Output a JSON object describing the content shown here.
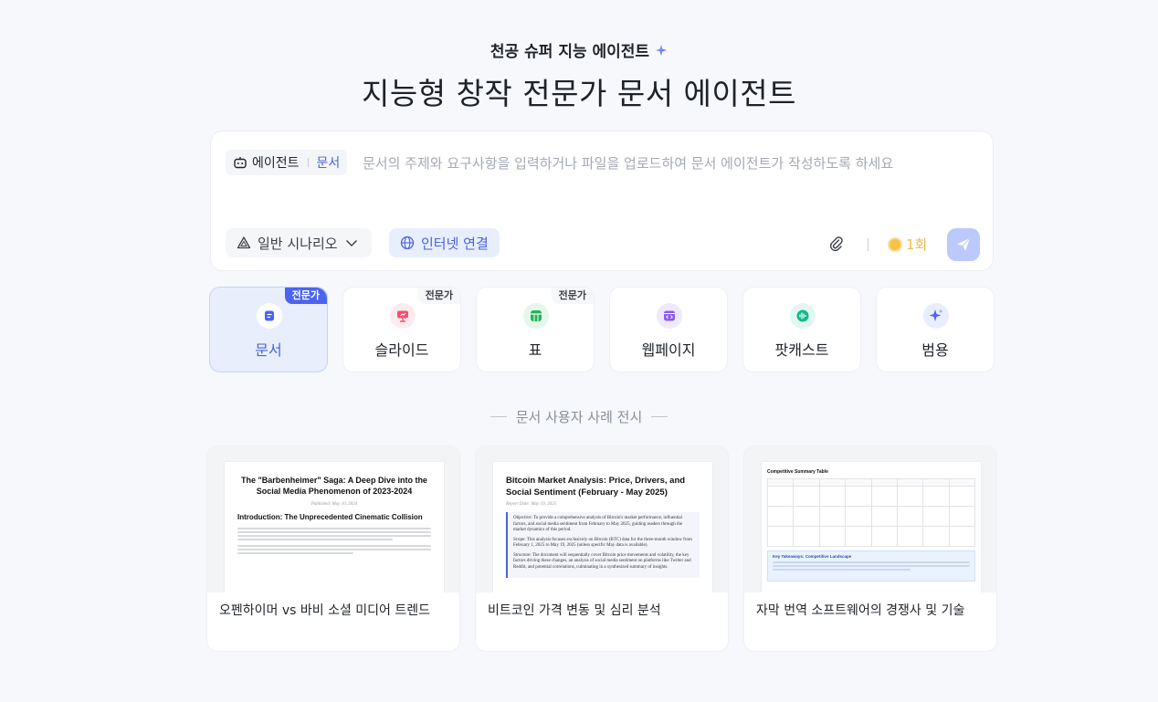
{
  "header": {
    "eyebrow": "천공 슈퍼 지능 에이전트",
    "headline": "지능형 창작 전문가 문서 에이전트"
  },
  "composer": {
    "agent_label": "에이전트",
    "agent_type": "문서",
    "placeholder": "문서의 주제와 요구사항을 입력하거나 파일을 업로드하여 문서 에이전트가 작성하도록 하세요",
    "scenario_label": "일반 시나리오",
    "internet_label": "인터넷 연결",
    "credits_label": "1회"
  },
  "categories": [
    {
      "label": "문서",
      "badge": "전문가",
      "active": true
    },
    {
      "label": "슬라이드",
      "badge": "전문가"
    },
    {
      "label": "표",
      "badge": "전문가"
    },
    {
      "label": "웹페이지"
    },
    {
      "label": "팟캐스트"
    },
    {
      "label": "범용"
    }
  ],
  "showcase": {
    "title": "문서 사용자 사례 전시",
    "cases": [
      {
        "caption": "오펜하이머 vs 바비 소셜 미디어 트렌드",
        "doc_title": "The \"Barbenheimer\" Saga: A Deep Dive into the Social Media Phenomenon of 2023-2024",
        "doc_meta": "Published: May 10, 2024",
        "doc_heading": "Introduction: The Unprecedented Cinematic Collision"
      },
      {
        "caption": "비트코인 가격 변동 및 심리 분석",
        "doc_title": "Bitcoin Market Analysis: Price, Drivers, and Social Sentiment (February - May 2025)",
        "doc_meta": "Report Date: May 19, 2025",
        "objective": "Objective: To provide a comprehensive analysis of Bitcoin's market performance, influential factors, and social media sentiment from February to May 2025, guiding readers through the market dynamics of this period.",
        "scope": "Scope: This analysis focuses exclusively on Bitcoin (BTC) data for the three-month window from February 1, 2025 to May 19, 2025 (unless specific May data is available).",
        "structure": "Structure: The document will sequentially cover Bitcoin price movements and volatility, the key factors driving these changes, an analysis of social media sentiment on platforms like Twitter and Reddit, and potential correlations, culminating in a synthesized summary of insights."
      },
      {
        "caption": "자막 번역 소프트웨어의 경쟁사 및 기술",
        "doc_title": "Competitive Summary Table",
        "box_title": "Key Takeaways: Competitive Landscape"
      }
    ]
  },
  "colors": {
    "accent": "#4a64d8",
    "badge_active": "#4a64f0",
    "send_disabled": "#bcc9fb",
    "credits": "#f2b94a"
  },
  "icons": {
    "eyebrow": "sparkle-icon",
    "agent": "robot-icon",
    "scenario": "triangle-icon",
    "internet": "globe-icon",
    "attach": "paperclip-icon",
    "credits": "coin-icon",
    "send": "paper-plane-icon",
    "category_icons": [
      "document-icon",
      "presentation-icon",
      "table-icon",
      "webpage-icon",
      "podcast-icon",
      "sparkle-icon"
    ]
  }
}
